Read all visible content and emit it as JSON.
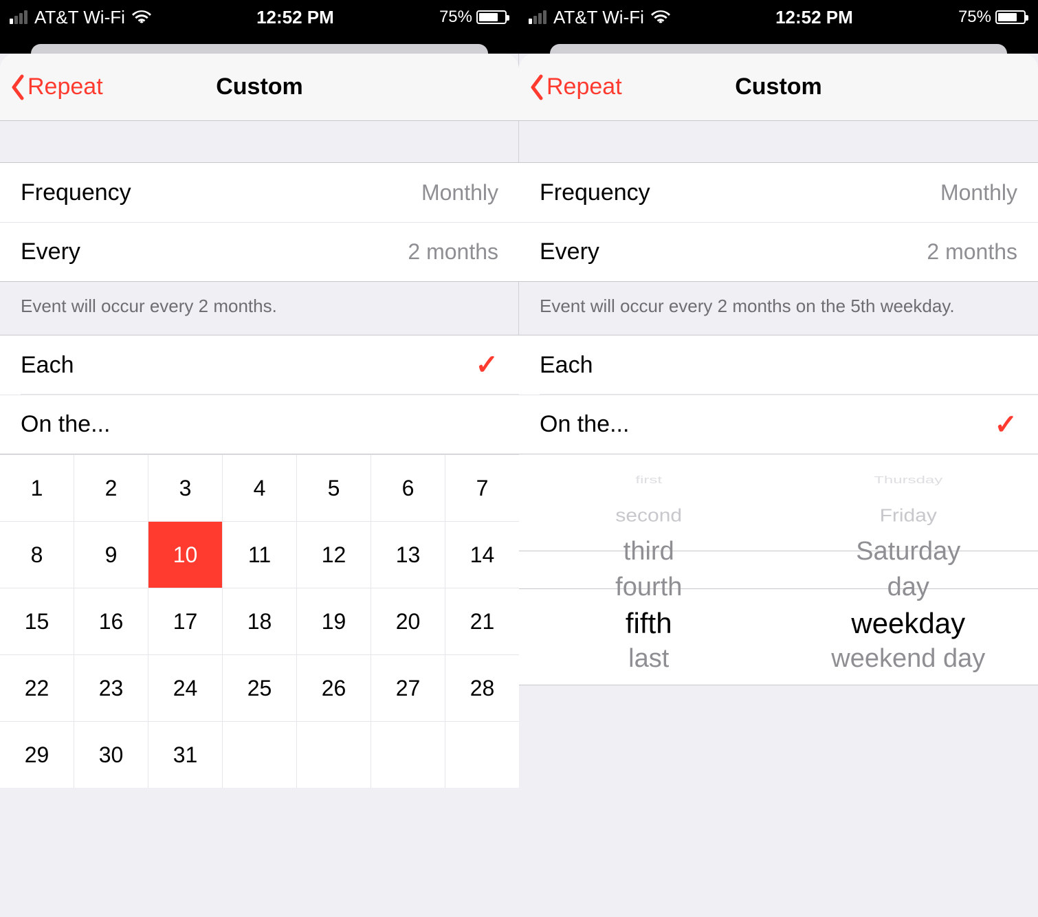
{
  "status": {
    "carrier": "AT&T Wi-Fi",
    "time": "12:52 PM",
    "battery_pct": "75%",
    "battery_fill_pct": 75
  },
  "nav": {
    "back_label": "Repeat",
    "title": "Custom"
  },
  "settings": {
    "frequency_label": "Frequency",
    "frequency_value": "Monthly",
    "every_label": "Every",
    "every_value": "2 months"
  },
  "left": {
    "footer": "Event will occur every 2 months.",
    "each_label": "Each",
    "onthe_label": "On the...",
    "selected_mode": "each",
    "days": [
      "1",
      "2",
      "3",
      "4",
      "5",
      "6",
      "7",
      "8",
      "9",
      "10",
      "11",
      "12",
      "13",
      "14",
      "15",
      "16",
      "17",
      "18",
      "19",
      "20",
      "21",
      "22",
      "23",
      "24",
      "25",
      "26",
      "27",
      "28",
      "29",
      "30",
      "31"
    ],
    "selected_day": "10"
  },
  "right": {
    "footer": "Event will occur every 2 months on the 5th weekday.",
    "each_label": "Each",
    "onthe_label": "On the...",
    "selected_mode": "onthe",
    "picker_ordinal": {
      "xfar_above": "first",
      "far_above": "second",
      "near_above2": "third",
      "near_above": "fourth",
      "selected": "fifth",
      "near_below": "last"
    },
    "picker_day": {
      "xfar_above": "Thursday",
      "far_above": "Friday",
      "near_above2": "Saturday",
      "near_above": "day",
      "selected": "weekday",
      "near_below": "weekend day"
    }
  },
  "checkmark_glyph": "✓"
}
